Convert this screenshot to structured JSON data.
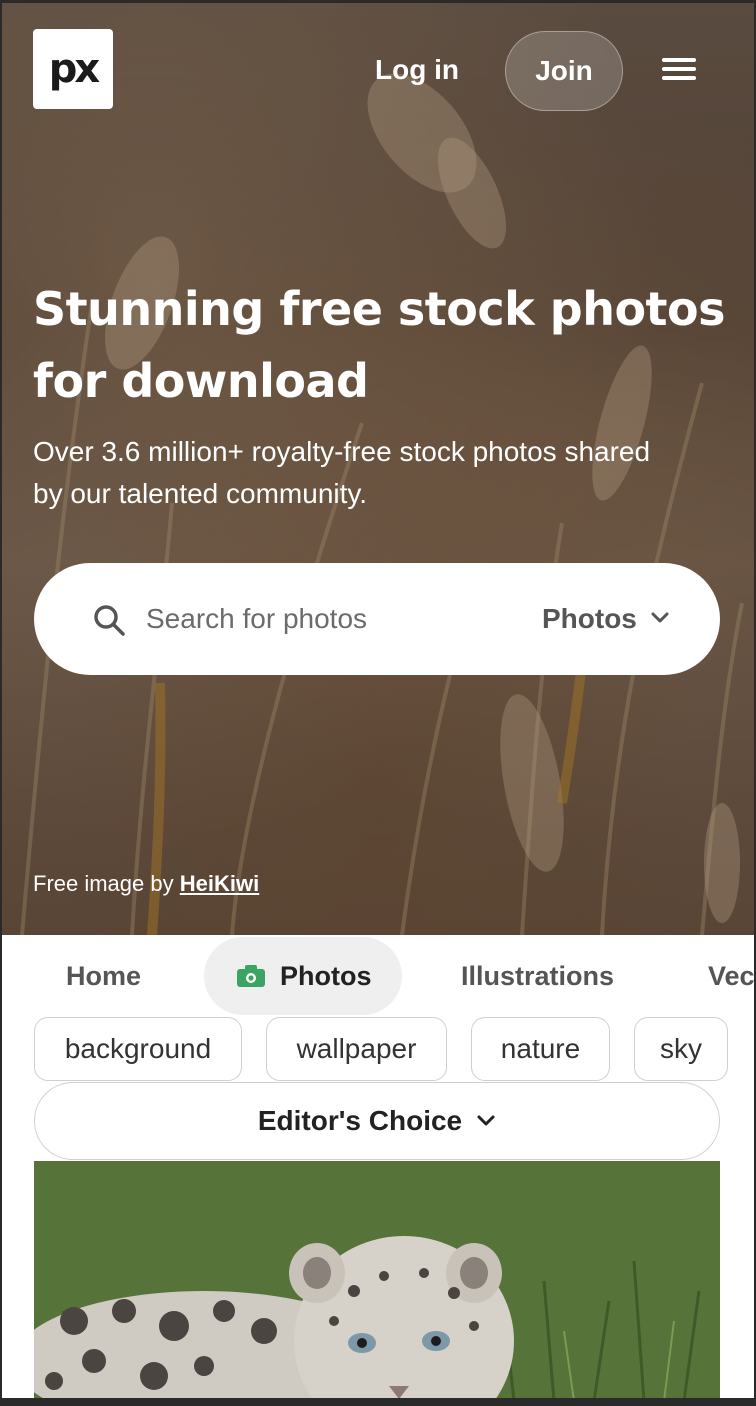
{
  "header": {
    "logo_text": "px",
    "login_label": "Log in",
    "join_label": "Join",
    "menu_icon": "hamburger-menu-icon"
  },
  "hero": {
    "headline_line1": "Stunning free stock photos",
    "headline_line2": "for download",
    "subtitle_line1": "Over 3.6 million+ royalty-free stock photos shared",
    "subtitle_line2": "by our talented community.",
    "search": {
      "placeholder": "Search for photos",
      "type_label": "Photos",
      "search_icon": "search-icon",
      "chevron_icon": "chevron-down-icon"
    },
    "credit_prefix": "Free image by",
    "credit_author": "HeiKiwi"
  },
  "tabs": [
    {
      "label": "Home"
    },
    {
      "label": "Photos",
      "icon": "camera-icon",
      "active": true
    },
    {
      "label": "Illustrations"
    },
    {
      "label": "Vec"
    }
  ],
  "tags": [
    "background",
    "wallpaper",
    "nature",
    "sky"
  ],
  "filter": {
    "label": "Editor's Choice",
    "chevron_icon": "chevron-down-icon"
  },
  "colors": {
    "accent_green": "#3aa464",
    "pill_bg": "#efefef"
  }
}
